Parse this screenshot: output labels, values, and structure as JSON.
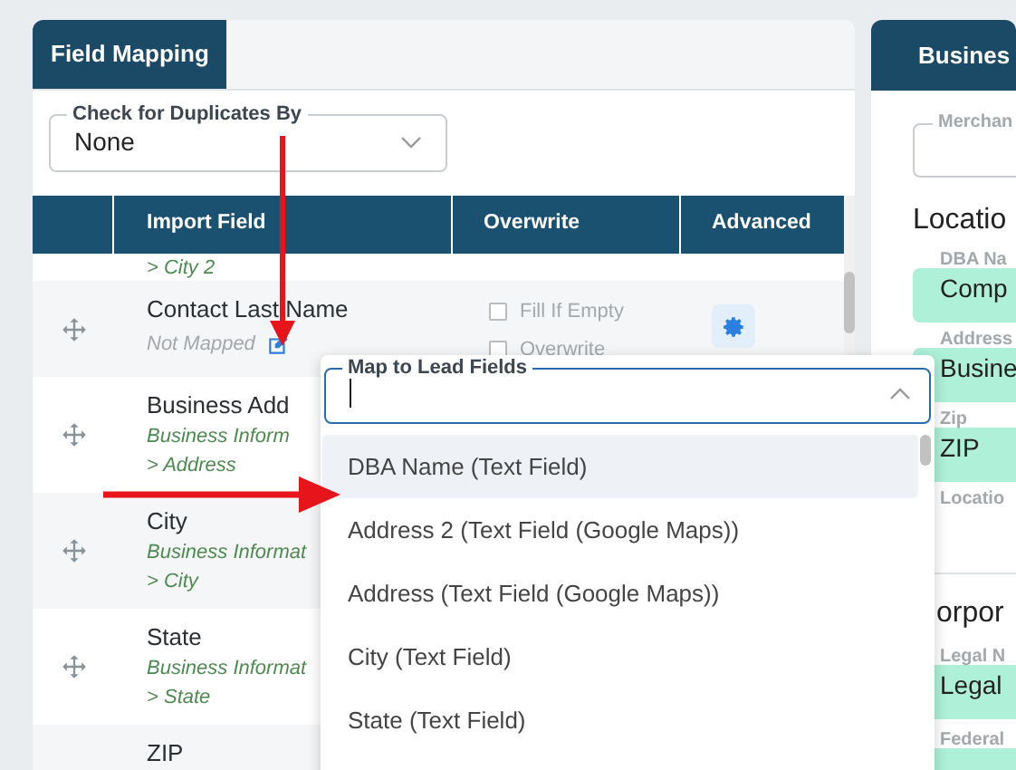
{
  "left_panel": {
    "tab": "Field Mapping",
    "duplicates_select": {
      "label": "Check for Duplicates By",
      "value": "None"
    },
    "table": {
      "columns": [
        "Import Field",
        "Overwrite",
        "Advanced"
      ],
      "rows": [
        {
          "mapping_lines": [
            "> City 2"
          ]
        },
        {
          "name": "Contact Last Name",
          "mapped": false,
          "mapping_lines": [
            "Not Mapped"
          ],
          "options": [
            {
              "label": "Fill If Empty",
              "checked": false,
              "disabled": true
            },
            {
              "label": "Overwrite",
              "checked": false,
              "disabled": true
            }
          ],
          "advanced": true
        },
        {
          "name": "Business Add",
          "mapping_lines": [
            "Business Inform",
            "> Address"
          ]
        },
        {
          "name": "City",
          "mapping_lines": [
            "Business Informat",
            "> City"
          ]
        },
        {
          "name": "State",
          "mapping_lines": [
            "Business Informat",
            "> State"
          ]
        },
        {
          "name": "ZIP",
          "mapping_lines": []
        }
      ]
    }
  },
  "right_panel": {
    "tab": "Busines",
    "merchant_label": "Merchan",
    "heading": "Locatio",
    "fields": [
      {
        "label": "DBA Na",
        "value": "Comp"
      },
      {
        "label": "Address",
        "value": "Busine"
      },
      {
        "label": "Zip",
        "value": "ZIP"
      },
      {
        "label": "Locatio"
      }
    ],
    "heading_2": "orpor",
    "fields_2": [
      {
        "label": "Legal N",
        "value": "Legal"
      },
      {
        "label": "Federal"
      }
    ]
  },
  "popup": {
    "label": "Map to Lead Fields",
    "options": [
      {
        "label": "DBA Name (Text Field)",
        "selected": true
      },
      {
        "label": "Address 2 (Text Field (Google Maps))",
        "selected": false
      },
      {
        "label": "Address (Text Field (Google Maps))",
        "selected": false
      },
      {
        "label": "City (Text Field)",
        "selected": false
      },
      {
        "label": "State (Text Field)",
        "selected": false
      }
    ]
  }
}
